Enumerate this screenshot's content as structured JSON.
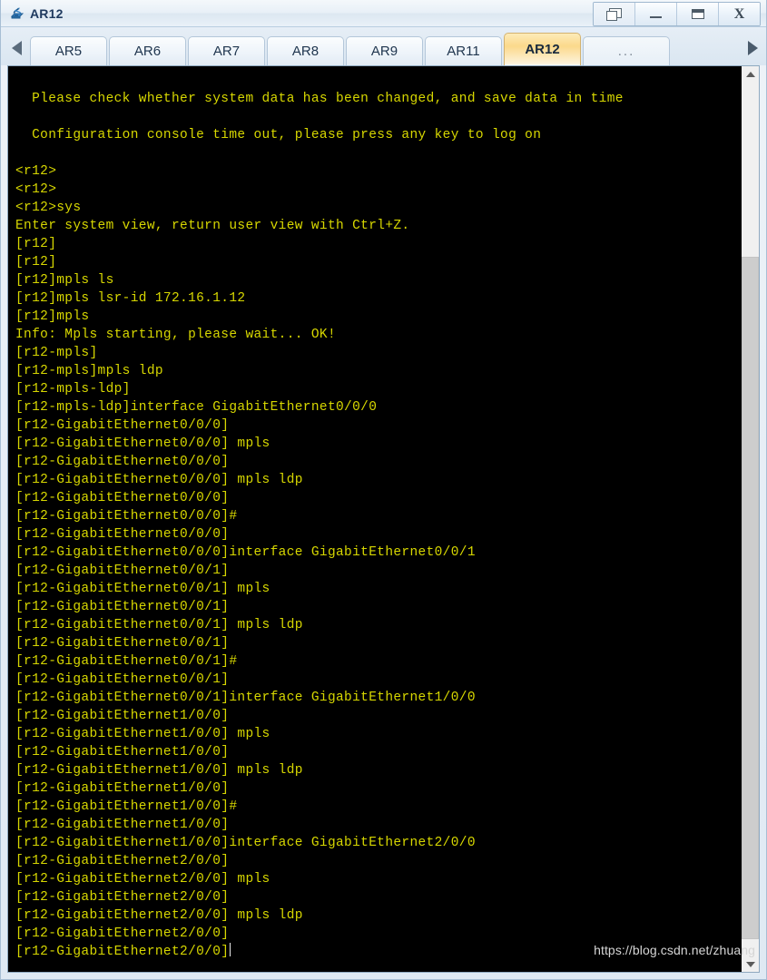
{
  "window": {
    "title": "AR12",
    "icon": "router-icon",
    "controls": [
      {
        "name": "cascade-button",
        "icon": "cascade-icon",
        "label": ""
      },
      {
        "name": "minimize-button",
        "icon": "minimize-icon",
        "label": ""
      },
      {
        "name": "maximize-button",
        "icon": "maximize-icon",
        "label": ""
      },
      {
        "name": "close-button",
        "icon": "close-icon",
        "label": "X"
      }
    ]
  },
  "tabbar": {
    "scroll_left_icon": "arrow-left-icon",
    "scroll_right_icon": "arrow-right-icon",
    "active_tab": "AR12",
    "tabs": [
      {
        "label": "AR5"
      },
      {
        "label": "AR6"
      },
      {
        "label": "AR7"
      },
      {
        "label": "AR8"
      },
      {
        "label": "AR9"
      },
      {
        "label": "AR11"
      },
      {
        "label": "AR12"
      },
      {
        "label": "..."
      }
    ]
  },
  "terminal": {
    "background_color": "#000000",
    "text_color": "#d7d700",
    "cursor_color": "#e8e8e8",
    "watermark": "https://blog.csdn.net/zhuang",
    "lines": [
      "",
      "  Please check whether system data has been changed, and save data in time",
      "",
      "  Configuration console time out, please press any key to log on",
      "",
      "<r12>",
      "<r12>",
      "<r12>sys",
      "Enter system view, return user view with Ctrl+Z.",
      "[r12]",
      "[r12]",
      "[r12]mpls ls",
      "[r12]mpls lsr-id 172.16.1.12",
      "[r12]mpls",
      "Info: Mpls starting, please wait... OK!",
      "[r12-mpls]",
      "[r12-mpls]mpls ldp",
      "[r12-mpls-ldp]",
      "[r12-mpls-ldp]interface GigabitEthernet0/0/0",
      "[r12-GigabitEthernet0/0/0]",
      "[r12-GigabitEthernet0/0/0] mpls",
      "[r12-GigabitEthernet0/0/0]",
      "[r12-GigabitEthernet0/0/0] mpls ldp",
      "[r12-GigabitEthernet0/0/0]",
      "[r12-GigabitEthernet0/0/0]#",
      "[r12-GigabitEthernet0/0/0]",
      "[r12-GigabitEthernet0/0/0]interface GigabitEthernet0/0/1",
      "[r12-GigabitEthernet0/0/1]",
      "[r12-GigabitEthernet0/0/1] mpls",
      "[r12-GigabitEthernet0/0/1]",
      "[r12-GigabitEthernet0/0/1] mpls ldp",
      "[r12-GigabitEthernet0/0/1]",
      "[r12-GigabitEthernet0/0/1]#",
      "[r12-GigabitEthernet0/0/1]",
      "[r12-GigabitEthernet0/0/1]interface GigabitEthernet1/0/0",
      "[r12-GigabitEthernet1/0/0]",
      "[r12-GigabitEthernet1/0/0] mpls",
      "[r12-GigabitEthernet1/0/0]",
      "[r12-GigabitEthernet1/0/0] mpls ldp",
      "[r12-GigabitEthernet1/0/0]",
      "[r12-GigabitEthernet1/0/0]#",
      "[r12-GigabitEthernet1/0/0]",
      "[r12-GigabitEthernet1/0/0]interface GigabitEthernet2/0/0",
      "[r12-GigabitEthernet2/0/0]",
      "[r12-GigabitEthernet2/0/0] mpls",
      "[r12-GigabitEthernet2/0/0]",
      "[r12-GigabitEthernet2/0/0] mpls ldp",
      "[r12-GigabitEthernet2/0/0]",
      "[r12-GigabitEthernet2/0/0]"
    ],
    "cursor_on_last_line": true
  },
  "scrollbar": {
    "up_icon": "chevron-up-icon",
    "down_icon": "chevron-down-icon",
    "thumb_top_percent": 20,
    "thumb_height_percent": 78
  }
}
